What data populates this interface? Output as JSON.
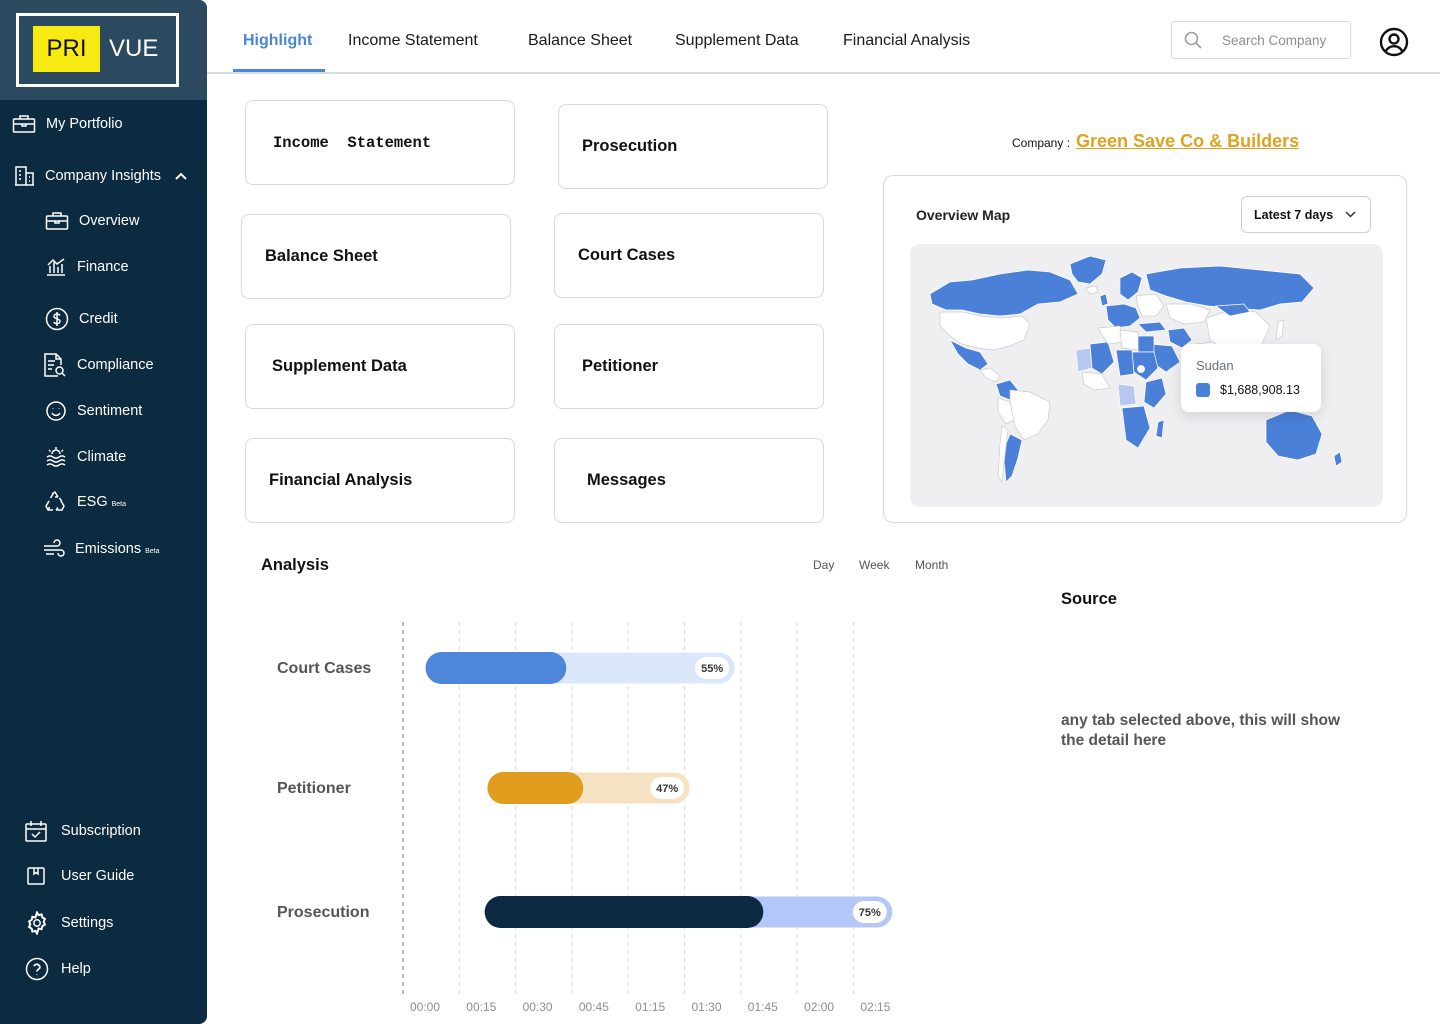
{
  "app": {
    "logo_left": "PRI",
    "logo_right": "VUE"
  },
  "sidebar": {
    "items": [
      {
        "label": "My Portfolio",
        "icon": "briefcase-icon"
      },
      {
        "label": "Company Insights",
        "icon": "building-icon"
      },
      {
        "label": "Overview",
        "icon": "briefcase-icon"
      },
      {
        "label": "Finance",
        "icon": "finance-chart-icon"
      },
      {
        "label": "Credit",
        "icon": "dollar-circle-icon"
      },
      {
        "label": "Compliance",
        "icon": "document-search-icon"
      },
      {
        "label": "Sentiment",
        "icon": "smiley-icon"
      },
      {
        "label": "Climate",
        "icon": "sun-waves-icon"
      },
      {
        "label": "ESG",
        "badge": "Beta",
        "icon": "recycle-icon"
      },
      {
        "label": "Emissions",
        "badge": "Beta",
        "icon": "wind-icon"
      }
    ],
    "bottom": [
      {
        "label": "Subscription",
        "icon": "calendar-check-icon"
      },
      {
        "label": "User Guide",
        "icon": "book-icon"
      },
      {
        "label": "Settings",
        "icon": "gear-icon"
      },
      {
        "label": "Help",
        "icon": "help-circle-icon"
      }
    ]
  },
  "tabs": [
    {
      "label": "Highlight",
      "active": true
    },
    {
      "label": "Income Statement"
    },
    {
      "label": "Balance Sheet"
    },
    {
      "label": "Supplement Data"
    },
    {
      "label": "Financial Analysis"
    }
  ],
  "search": {
    "placeholder": "Search Company"
  },
  "cards": {
    "left": [
      "Income  Statement",
      "Balance Sheet",
      "Supplement Data",
      "Financial Analysis"
    ],
    "right": [
      "Prosecution",
      "Court Cases",
      "Petitioner",
      "Messages"
    ]
  },
  "company": {
    "label": "Company :",
    "name": "Green Save Co & Builders"
  },
  "map": {
    "title": "Overview Map",
    "range": "Latest 7 days",
    "tooltip_country": "Sudan",
    "tooltip_value": "$1,688,908.13",
    "highlight_color": "#4a80d8"
  },
  "analysis": {
    "title": "Analysis",
    "periods": [
      "Day",
      "Week",
      "Month"
    ]
  },
  "chart_data": {
    "type": "bar",
    "orientation": "horizontal",
    "categories": [
      "Court Cases",
      "Petitioner",
      "Prosecution"
    ],
    "x_ticks": [
      "00:00",
      "00:15",
      "00:30",
      "00:45",
      "01:15",
      "01:30",
      "01:45",
      "02:00",
      "02:15"
    ],
    "bars": [
      {
        "category": "Court Cases",
        "start": 0.4,
        "fill_end": 2.9,
        "end": 5.9,
        "percent": "55%",
        "color": "#4e86db",
        "track": "#dbe8fb"
      },
      {
        "category": "Petitioner",
        "start": 1.5,
        "fill_end": 3.2,
        "end": 5.1,
        "percent": "47%",
        "color": "#e09c1c",
        "track": "#f5e2c2"
      },
      {
        "category": "Prosecution",
        "start": 1.45,
        "fill_end": 6.4,
        "end": 8.7,
        "percent": "75%",
        "color": "#0b2a42",
        "track": "#b3c8f8"
      }
    ]
  },
  "source": {
    "title": "Source",
    "text": "any tab selected above, this will show the detail here"
  }
}
